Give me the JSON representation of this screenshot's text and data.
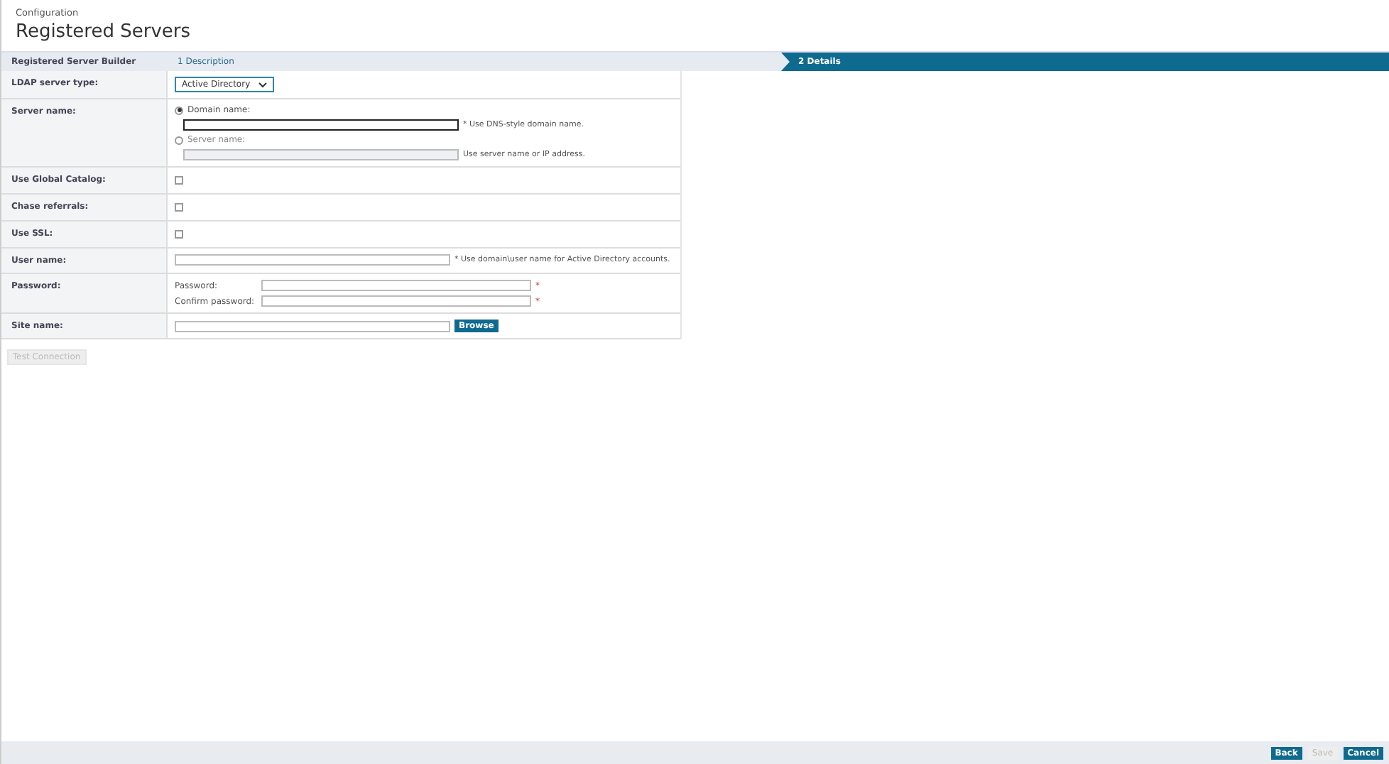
{
  "breadcrumb": "Configuration",
  "title": "Registered Servers",
  "builder": {
    "label": "Registered Server Builder",
    "steps": [
      {
        "label": "1 Description",
        "selected": false
      },
      {
        "label": "2 Details",
        "selected": true
      }
    ]
  },
  "rows": [
    {
      "kind": "select",
      "label": "LDAP server type:",
      "value": "Active Directory"
    },
    {
      "kind": "radios",
      "label": "Server name:",
      "options": [
        {
          "label": "Domain name:",
          "selected": true,
          "disabled": false,
          "hint": "* Use DNS-style domain name."
        },
        {
          "label": "Server name:",
          "selected": false,
          "disabled": true,
          "hint": "Use server name or IP address."
        }
      ]
    },
    {
      "kind": "checkbox",
      "label": "Use Global Catalog:",
      "checked": false
    },
    {
      "kind": "checkbox",
      "label": "Chase referrals:",
      "checked": false
    },
    {
      "kind": "checkbox",
      "label": "Use SSL:",
      "checked": false
    },
    {
      "kind": "text",
      "label": "User name:",
      "hint": "* Use domain\\user name for Active Directory accounts."
    },
    {
      "kind": "passwords",
      "label": "Password:",
      "fields": [
        {
          "label": "Password:",
          "required": "*"
        },
        {
          "label": "Confirm password:",
          "required": "*"
        }
      ]
    },
    {
      "kind": "browse",
      "label": "Site name:",
      "button": "Browse"
    }
  ],
  "test_button": {
    "label": "Test Connection",
    "disabled": true
  },
  "footer_buttons": [
    {
      "label": "Back",
      "disabled": false
    },
    {
      "label": "Save",
      "disabled": true
    },
    {
      "label": "Cancel",
      "disabled": false
    }
  ]
}
